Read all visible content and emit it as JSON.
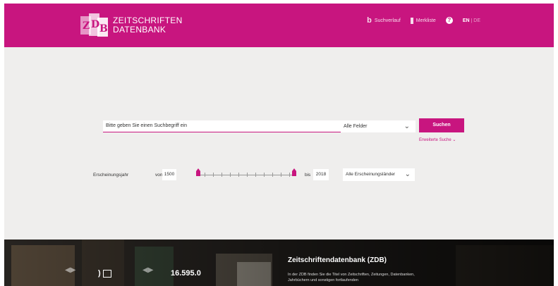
{
  "header": {
    "logo_line1": "ZEITSCHRIFTEN",
    "logo_line2": "DATENBANK",
    "nav": {
      "search_history": "Suchverlauf",
      "watchlist": "Merkliste",
      "help": "?",
      "lang_active": "EN",
      "lang_sep": " | ",
      "lang_other": "DE"
    },
    "brand_color": "#c8157f"
  },
  "search": {
    "input_placeholder": "Bitte geben Sie einen Suchbegriff ein",
    "folder_selected": "Alle Felder",
    "button_label": "Suchen",
    "extended_search": "Erweiterte Suche",
    "year_label": "Erscheinungsjahr",
    "year_von": "von",
    "year_from": "1500",
    "year_bis": "bis",
    "year_to": "2018",
    "country_selected": "Alle Erscheinungsländer"
  },
  "banner": {
    "stat_value": "16.595.0",
    "title": "Zeitschriftendatenbank (ZDB)",
    "text": "In der ZDB finden Sie die Titel von Zeitschriften, Zeitungen, Datenbanken, Jahrbüchern und sonstigen fortlaufenden"
  }
}
